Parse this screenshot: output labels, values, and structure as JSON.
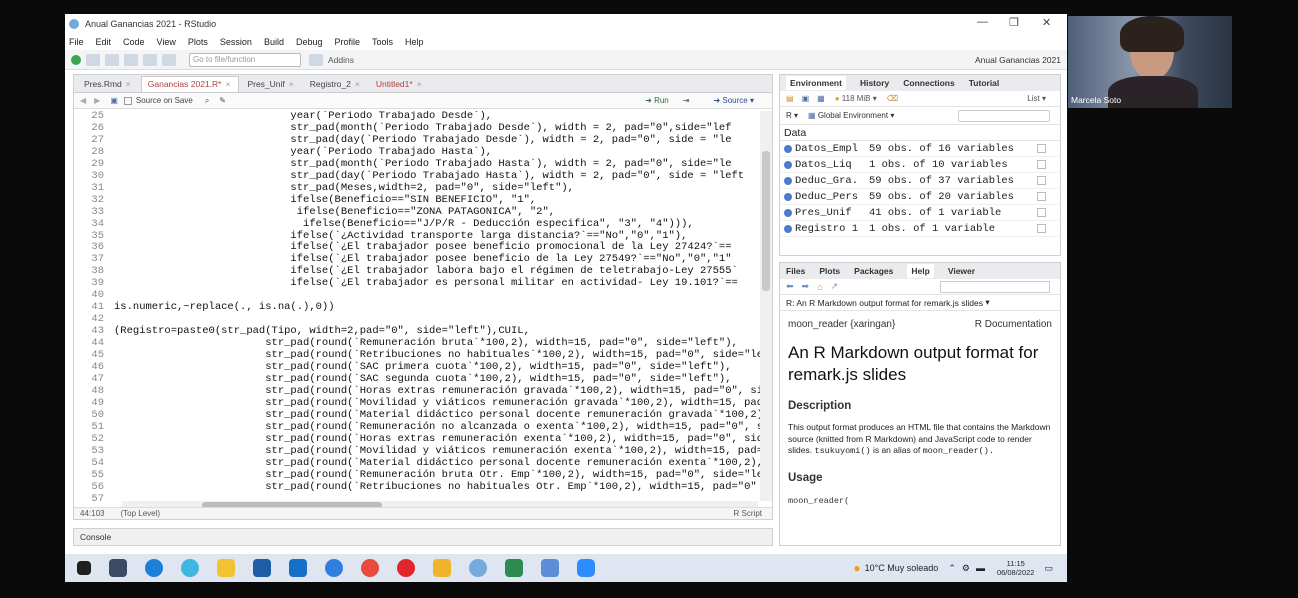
{
  "window": {
    "title": "Anual Ganancias 2021 - RStudio",
    "project": "Anual Ganancias 2021"
  },
  "menu": [
    "File",
    "Edit",
    "Code",
    "View",
    "Plots",
    "Session",
    "Build",
    "Debug",
    "Profile",
    "Tools",
    "Help"
  ],
  "toolbar": {
    "goto_placeholder": "Go to file/function",
    "addins": "Addins"
  },
  "editor": {
    "tabs": [
      {
        "label": "Pres.Rmd"
      },
      {
        "label": "Ganancias 2021.R*"
      },
      {
        "label": "Pres_Unif"
      },
      {
        "label": "Registro_2"
      },
      {
        "label": "Untitled1*"
      }
    ],
    "source_on_save": "Source on Save",
    "run": "Run",
    "source": "Source",
    "status_pos": "44:103",
    "status_level": "(Top Level)",
    "status_type": "R Script",
    "line_numbers": [
      "25",
      "26",
      "27",
      "28",
      "29",
      "30",
      "31",
      "32",
      "33",
      "34",
      "35",
      "36",
      "37",
      "38",
      "39",
      "40",
      "41",
      "42",
      "43",
      "44",
      "45",
      "46",
      "47",
      "48",
      "49",
      "50",
      "51",
      "52",
      "53",
      "54",
      "55",
      "56",
      "57"
    ],
    "lines": [
      "                            year(`Periodo Trabajado Desde`),",
      "                            str_pad(month(`Periodo Trabajado Desde`), width = 2, pad=\"0\",side=\"lef",
      "                            str_pad(day(`Periodo Trabajado Desde`), width = 2, pad=\"0\", side = \"le",
      "                            year(`Periodo Trabajado Hasta`),",
      "                            str_pad(month(`Periodo Trabajado Hasta`), width = 2, pad=\"0\", side=\"le",
      "                            str_pad(day(`Periodo Trabajado Hasta`), width = 2, pad=\"0\", side = \"left",
      "                            str_pad(Meses,width=2, pad=\"0\", side=\"left\"),",
      "                            ifelse(Beneficio==\"SIN BENEFICIO\", \"1\",",
      "                             ifelse(Beneficio==\"ZONA PATAGONICA\", \"2\",",
      "                              ifelse(Beneficio==\"J/P/R - Deducción especifica\", \"3\", \"4\"))),",
      "                            ifelse(`¿Actividad transporte larga distancia?`==\"No\",\"0\",\"1\"),",
      "                            ifelse(`¿El trabajador posee beneficio promocional de la Ley 27424?`==",
      "                            ifelse(`¿El trabajador posee beneficio de la Ley 27549?`==\"No\",\"0\",\"1\"",
      "                            ifelse(`¿El trabajador labora bajo el régimen de teletrabajo-Ley 27555`",
      "                            ifelse(`¿El trabajador es personal militar en actividad- Ley 19.101?`==",
      "",
      "is.numeric,~replace(., is.na(.),0))",
      "",
      "(Registro=paste0(str_pad(Tipo, width=2,pad=\"0\", side=\"left\"),CUIL,",
      "                        str_pad(round(`Remuneración bruta`*100,2), width=15, pad=\"0\", side=\"left\"),",
      "                        str_pad(round(`Retribuciones no habituales`*100,2), width=15, pad=\"0\", side=\"le",
      "                        str_pad(round(`SAC primera cuota`*100,2), width=15, pad=\"0\", side=\"left\"),",
      "                        str_pad(round(`SAC segunda cuota`*100,2), width=15, pad=\"0\", side=\"left\"),",
      "                        str_pad(round(`Horas extras remuneración gravada`*100,2), width=15, pad=\"0\", si",
      "                        str_pad(round(`Movilidad y viáticos remuneración gravada`*100,2), width=15, pad",
      "                        str_pad(round(`Material didáctico personal docente remuneración gravada`*100,2)",
      "                        str_pad(round(`Remuneración no alcanzada o exenta`*100,2), width=15, pad=\"0\", s",
      "                        str_pad(round(`Horas extras remuneración exenta`*100,2), width=15, pad=\"0\", sid",
      "                        str_pad(round(`Movilidad y viáticos remuneración exenta`*100,2), width=15, pad=",
      "                        str_pad(round(`Material didáctico personal docente remuneración exenta`*100,2),",
      "                        str_pad(round(`Remuneración bruta Otr. Emp`*100,2), width=15, pad=\"0\", side=\"le",
      "                        str_pad(round(`Retribuciones no habituales Otr. Emp`*100,2), width=15, pad=\"0\"",
      ""
    ]
  },
  "console": {
    "label": "Console"
  },
  "env": {
    "tabs": [
      "Environment",
      "History",
      "Connections",
      "Tutorial"
    ],
    "memory": "118 MiB",
    "list_label": "List",
    "r_label": "R",
    "scope": "Global Environment",
    "section": "Data",
    "rows": [
      {
        "name": "Datos_Empl",
        "value": "59 obs. of 16 variables"
      },
      {
        "name": "Datos_Liq",
        "value": "1 obs. of 10 variables"
      },
      {
        "name": "Deduc_Gra.",
        "value": "59 obs. of 37 variables"
      },
      {
        "name": "Deduc_Pers",
        "value": "59 obs. of 20 variables"
      },
      {
        "name": "Pres_Unif",
        "value": "41 obs. of 1 variable"
      },
      {
        "name": "Registro 1",
        "value": "1 obs. of 1 variable"
      }
    ]
  },
  "help": {
    "tabs": [
      "Files",
      "Plots",
      "Packages",
      "Help",
      "Viewer"
    ],
    "topic": "R: An R Markdown output format for remark.js slides",
    "doc_left": "moon_reader {xaringan}",
    "doc_right": "R Documentation",
    "title": "An R Markdown output format for remark.js slides",
    "desc_head": "Description",
    "desc_body": "This output format produces an HTML file that contains the Markdown source (knitted from R Markdown) and JavaScript code to render slides.",
    "desc_alias_code": "tsukuyomi()",
    "desc_alias_text": "is an alias of",
    "desc_alias_target": "moon_reader().",
    "usage_head": "Usage",
    "usage_code": "moon_reader("
  },
  "taskbar": {
    "weather": "10°C  Muy soleado",
    "time": "11:15",
    "date": "06/08/2022"
  },
  "webcam": {
    "name": "Marcela Soto"
  }
}
